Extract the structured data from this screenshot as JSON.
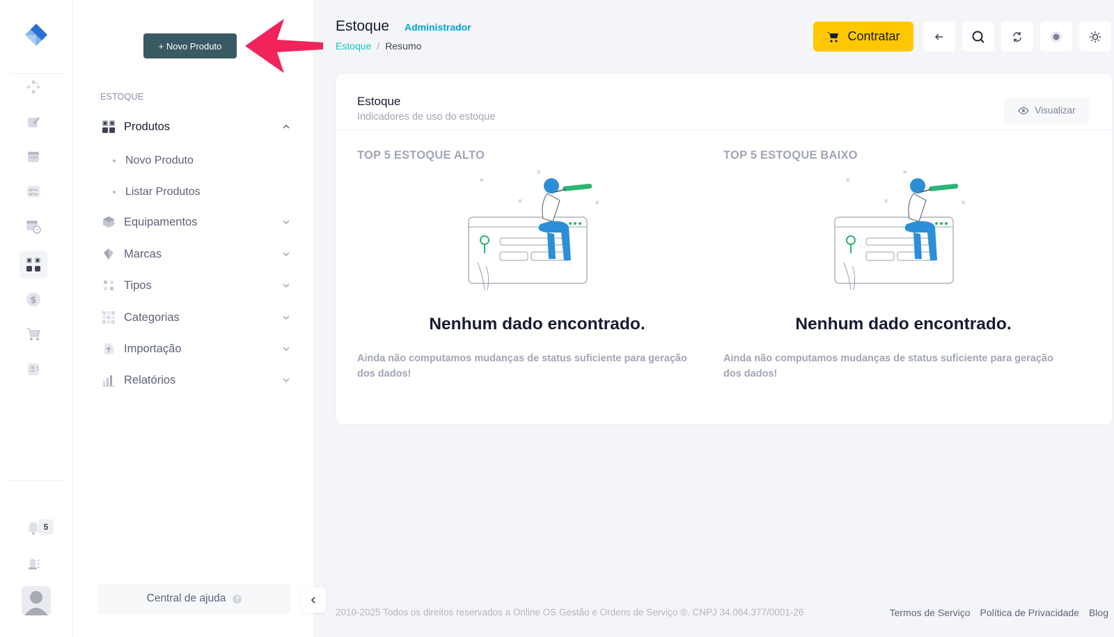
{
  "sidebar": {
    "new_product_label": "+ Novo Produto",
    "section_label": "ESTOQUE",
    "items": [
      {
        "label": "Produtos"
      },
      {
        "label": "Equipamentos"
      },
      {
        "label": "Marcas"
      },
      {
        "label": "Tipos"
      },
      {
        "label": "Categorias"
      },
      {
        "label": "Importação"
      },
      {
        "label": "Relatórios"
      }
    ],
    "subitems": [
      {
        "label": "Novo Produto"
      },
      {
        "label": "Listar Produtos"
      }
    ],
    "help_label": "Central de ajuda",
    "help_badge": "?"
  },
  "rail": {
    "notifications_count": "5",
    "icons": [
      "dashboard-icon",
      "edit-icon",
      "calendar-list-icon",
      "checklist-icon",
      "schedule-icon",
      "grid-icon",
      "dollar-icon",
      "cart-icon",
      "contacts-icon",
      "bell-icon",
      "alarm-icon",
      "user-avatar"
    ]
  },
  "header": {
    "title": "Estoque",
    "role": "Administrador",
    "breadcrumb": {
      "first": "Estoque",
      "separator": "/",
      "current": "Resumo"
    },
    "cta_label": "Contratar",
    "accent": "#ffc700"
  },
  "card": {
    "title": "Estoque",
    "subtitle": "Indicadores de uso do estoque",
    "view_label": "Visualizar",
    "columns": [
      {
        "heading": "TOP 5 ESTOQUE ALTO",
        "empty_title": "Nenhum dado encontrado.",
        "empty_desc": "Ainda não computamos mudanças de status suficiente para geração dos dados!"
      },
      {
        "heading": "TOP 5 ESTOQUE BAIXO",
        "empty_title": "Nenhum dado encontrado.",
        "empty_desc": "Ainda não computamos mudanças de status suficiente para geração dos dados!"
      }
    ]
  },
  "footer": {
    "copyright": "2010-2025 Todos os direitos reservados a Online OS Gestão e Ordens de Serviço ®. CNPJ 34.064.377/0001-26",
    "links": [
      "Termos de Serviço",
      "Política de Privacidade",
      "Blog"
    ]
  }
}
